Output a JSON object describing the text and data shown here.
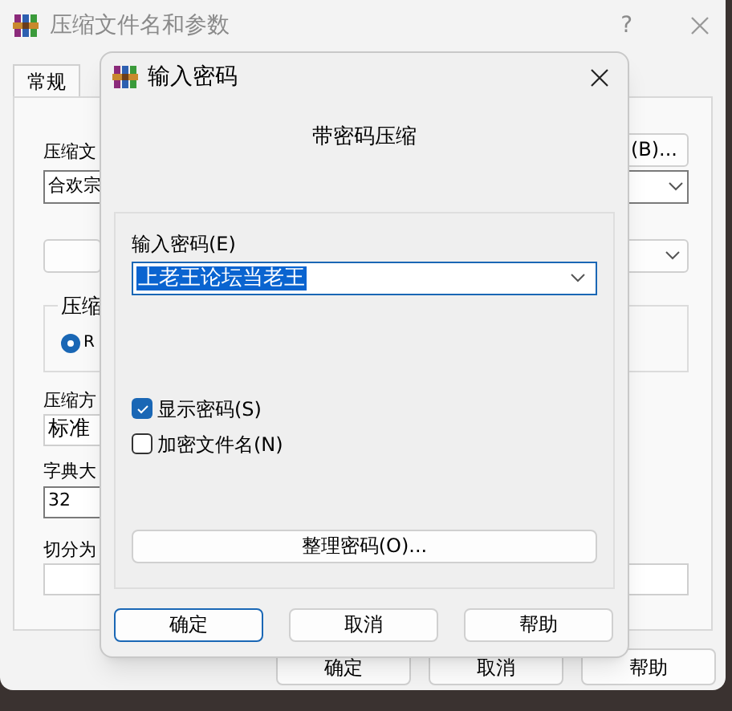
{
  "window": {
    "title": "压缩文件名和参数",
    "help": "?"
  },
  "tabs": [
    {
      "label": "常规",
      "selected": true
    }
  ],
  "form": {
    "archive_label": "压缩文",
    "archive_value": "合欢宗",
    "browse_button": "(B)...",
    "group_label": "压缩",
    "radio": {
      "label": "R",
      "selected": true
    },
    "method_label": "压缩方",
    "method_value": "标准",
    "dictionary_label": "字典大",
    "dictionary_value": "32",
    "split_label": "切分为"
  },
  "bottom_buttons": [
    {
      "label": "确定"
    },
    {
      "label": "取消"
    },
    {
      "label": "帮助"
    }
  ],
  "dialog": {
    "title": "输入密码",
    "heading": "带密码压缩",
    "password_label": "输入密码(E)",
    "password_value": "上老王论坛当老王",
    "value_selected": true,
    "checkboxes": [
      {
        "label": "显示密码(S)",
        "checked": true
      },
      {
        "label": "加密文件名(N)",
        "checked": false
      }
    ],
    "organize_button": "整理密码(O)...",
    "buttons": [
      {
        "label": "确定",
        "default": true
      },
      {
        "label": "取消",
        "default": false
      },
      {
        "label": "帮助",
        "default": false
      }
    ]
  }
}
